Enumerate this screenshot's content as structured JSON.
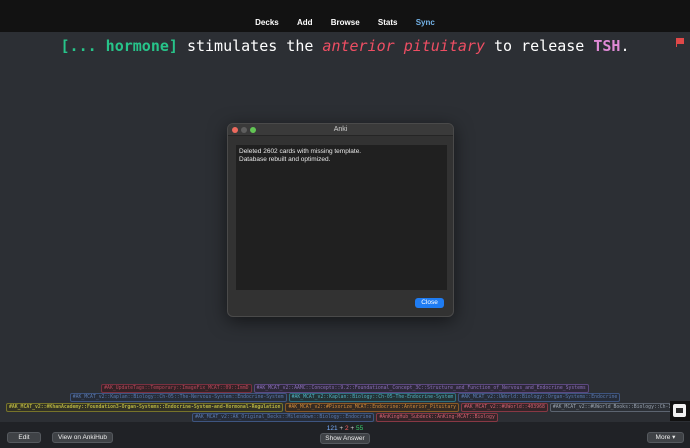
{
  "nav": {
    "items": [
      "Decks",
      "Add",
      "Browse",
      "Stats",
      "Sync"
    ],
    "active": "Sync"
  },
  "card": {
    "cloze": "[... hormone]",
    "text1": " stimulates the ",
    "italic": "anterior pituitary",
    "text2": " to release ",
    "bold_term": "TSH",
    "end": "."
  },
  "dialog": {
    "title": "Anki",
    "line1": "Deleted 2602 cards with missing template.",
    "line2": "Database rebuilt and optimized.",
    "close_label": "Close"
  },
  "tags": {
    "row1": [
      "#AK_UpdateTags::Temporary::ImageFix_MCAT::09::ImmD",
      "#AK_MCAT_v2::AAMC::Concepts::9.2::Foundational_Concept_3C::Structure_and_Function_of_Nervous_and_Endocrine_Systems"
    ],
    "row2": [
      "#AK_MCAT_v2::Kaplan::Biology::Ch-05::The-Nervous-System::Endocrine-System",
      "#AK_MCAT_v2::Kaplan::Biology::Ch-05-The-Endocrine-System",
      "#AK_MCAT_v2::UWorld::Biology::Organ-Systems::Endocrine"
    ],
    "row3": [
      "#AK_MCAT_v2::#KhanAcademy::Foundation3-Organ-Systems::Endocrine-System-and-Hormonal-Regulation",
      "#AK_MCAT_v2::#Pixorize_MCAT::Endocrine::Anterior_Pituitary",
      "#AK_MCAT_v2::#UWorld::403968",
      "#AK_MCAT_v2::#UWorld_Books::Biology::Ch-13-Endocrine"
    ],
    "row4": [
      "#AK_MCAT_v2::AK_Original_Decks::Milesdown::Biology::Endocrine",
      "#AnKingHub_Subdeck::AnKing-MCAT::Biology"
    ]
  },
  "counts": {
    "new": "121",
    "plus1": " + ",
    "learn": "2",
    "plus2": " + ",
    "review": "55"
  },
  "buttons": {
    "edit": "Edit",
    "hub": "View on AnkiHub",
    "show": "Show Answer",
    "more": "More ▾"
  },
  "colors": {
    "accent": "#1f7cf2",
    "cloze": "#27c48a",
    "pituitary": "#ee4e63",
    "tsh": "#e08ad6"
  }
}
